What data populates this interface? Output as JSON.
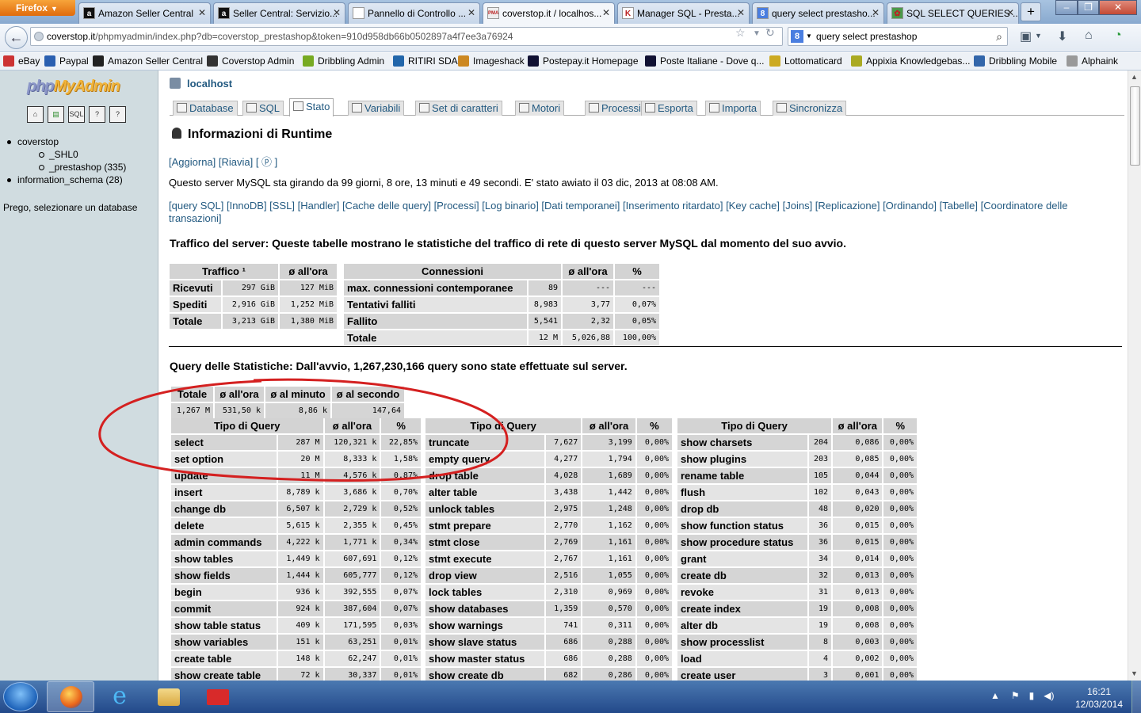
{
  "browser": {
    "app_button": "Firefox",
    "tabs": [
      {
        "label": "Amazon Seller Central",
        "fav": "a"
      },
      {
        "label": "Seller Central: Servizio...",
        "fav": "a"
      },
      {
        "label": "Pannello di Controllo ...",
        "fav": ""
      },
      {
        "label": "coverstop.it / localhos...",
        "fav": "PMA"
      },
      {
        "label": "Manager SQL - Presta...",
        "fav": "K"
      },
      {
        "label": "query select prestasho...",
        "fav": "8"
      },
      {
        "label": "SQL SELECT QUERIES ...",
        "fav": "✿"
      }
    ],
    "url_host": "coverstop.it",
    "url_path": "/phpmyadmin/index.php?db=coverstop_prestashop&token=910d958db66b0502897a4f7ee3a76924",
    "search_value": "query select prestashop",
    "bookmarks": [
      "eBay",
      "Paypal",
      "Amazon Seller Central",
      "Coverstop Admin",
      "Dribbling Admin",
      "RITIRI SDA",
      "Imageshack",
      "Postepay.it Homepage",
      "Poste Italiane - Dove q...",
      "Lottomaticard",
      "Appixia Knowledgebas...",
      "Dribbling Mobile",
      "Alphaink"
    ]
  },
  "sidebar": {
    "logo_php": "php",
    "logo_rest": "MyAdmin",
    "quick_icons": [
      "home-icon",
      "exit-icon",
      "sql-icon",
      "docs-icon",
      "help-icon"
    ],
    "db1": "coverstop",
    "db1_sub": [
      "_SHL0",
      "_prestashop (335)"
    ],
    "db2": "information_schema (28)",
    "select_prompt": "Prego, selezionare un database"
  },
  "main": {
    "server": "localhost",
    "tabs": [
      "Database",
      "SQL",
      "Stato",
      "Variabili",
      "Set di caratteri",
      "Motori",
      "Processi",
      "Esporta",
      "Importa",
      "Sincronizza"
    ],
    "active_tab": "Stato",
    "title": "Informazioni di Runtime",
    "links1": "[Aggiorna] [Riavia] [ ⓟ ]",
    "uptime": "Questo server MySQL sta girando da 99 giorni, 8 ore, 13 minuti e 49 secondi. E' stato awiato il 03 dic, 2013 at 08:08 AM.",
    "links2": "[query SQL] [InnoDB] [SSL] [Handler] [Cache delle query] [Processi] [Log binario] [Dati temporanei] [Inserimento ritardato] [Key cache] [Joins] [Replicazione] [Ordinando] [Tabelle] [Coordinatore delle transazioni]",
    "traffic_heading": "Traffico del server: Queste tabelle mostrano le statistiche del traffico di rete di questo server MySQL dal momento del suo avvio.",
    "query_heading": "Query delle Statistiche: Dall'avvio, 1,267,230,166 query sono state effettuate sul server."
  },
  "traffic": {
    "headers": [
      "Traffico ¹",
      "ø all'ora"
    ],
    "rows": [
      [
        "Ricevuti",
        "297 GiB",
        "127 MiB"
      ],
      [
        "Spediti",
        "2,916 GiB",
        "1,252 MiB"
      ],
      [
        "Totale",
        "3,213 GiB",
        "1,380 MiB"
      ]
    ]
  },
  "connections": {
    "headers": [
      "Connessioni",
      "ø all'ora",
      "%"
    ],
    "rows": [
      [
        "max. connessioni contemporanee",
        "89",
        "---",
        "---"
      ],
      [
        "Tentativi falliti",
        "8,983",
        "3,77",
        "0,07%"
      ],
      [
        "Fallito",
        "5,541",
        "2,32",
        "0,05%"
      ],
      [
        "Totale",
        "12 M",
        "5,026,88",
        "100,00%"
      ]
    ]
  },
  "query_totals": {
    "headers": [
      "Totale",
      "ø all'ora",
      "ø al minuto",
      "ø al secondo"
    ],
    "row": [
      "1,267 M",
      "531,50 k",
      "8,86 k",
      "147,64"
    ]
  },
  "query_types": {
    "headers": [
      "Tipo di Query",
      "ø all'ora",
      "%"
    ],
    "col1": [
      [
        "select",
        "287 M",
        "120,321 k",
        "22,85%"
      ],
      [
        "set option",
        "20 M",
        "8,333 k",
        "1,58%"
      ],
      [
        "update",
        "11 M",
        "4,576 k",
        "0,87%"
      ],
      [
        "insert",
        "8,789 k",
        "3,686 k",
        "0,70%"
      ],
      [
        "change db",
        "6,507 k",
        "2,729 k",
        "0,52%"
      ],
      [
        "delete",
        "5,615 k",
        "2,355 k",
        "0,45%"
      ],
      [
        "admin commands",
        "4,222 k",
        "1,771 k",
        "0,34%"
      ],
      [
        "show tables",
        "1,449 k",
        "607,691",
        "0,12%"
      ],
      [
        "show fields",
        "1,444 k",
        "605,777",
        "0,12%"
      ],
      [
        "begin",
        "936 k",
        "392,555",
        "0,07%"
      ],
      [
        "commit",
        "924 k",
        "387,604",
        "0,07%"
      ],
      [
        "show table status",
        "409 k",
        "171,595",
        "0,03%"
      ],
      [
        "show variables",
        "151 k",
        "63,251",
        "0,01%"
      ],
      [
        "create table",
        "148 k",
        "62,247",
        "0,01%"
      ],
      [
        "show create table",
        "72 k",
        "30,337",
        "0,01%"
      ]
    ],
    "col2": [
      [
        "truncate",
        "7,627",
        "3,199",
        "0,00%"
      ],
      [
        "empty query",
        "4,277",
        "1,794",
        "0,00%"
      ],
      [
        "drop table",
        "4,028",
        "1,689",
        "0,00%"
      ],
      [
        "alter table",
        "3,438",
        "1,442",
        "0,00%"
      ],
      [
        "unlock tables",
        "2,975",
        "1,248",
        "0,00%"
      ],
      [
        "stmt prepare",
        "2,770",
        "1,162",
        "0,00%"
      ],
      [
        "stmt close",
        "2,769",
        "1,161",
        "0,00%"
      ],
      [
        "stmt execute",
        "2,767",
        "1,161",
        "0,00%"
      ],
      [
        "drop view",
        "2,516",
        "1,055",
        "0,00%"
      ],
      [
        "lock tables",
        "2,310",
        "0,969",
        "0,00%"
      ],
      [
        "show databases",
        "1,359",
        "0,570",
        "0,00%"
      ],
      [
        "show warnings",
        "741",
        "0,311",
        "0,00%"
      ],
      [
        "show slave status",
        "686",
        "0,288",
        "0,00%"
      ],
      [
        "show master status",
        "686",
        "0,288",
        "0,00%"
      ],
      [
        "show create db",
        "682",
        "0,286",
        "0,00%"
      ]
    ],
    "col3": [
      [
        "show charsets",
        "204",
        "0,086",
        "0,00%"
      ],
      [
        "show plugins",
        "203",
        "0,085",
        "0,00%"
      ],
      [
        "rename table",
        "105",
        "0,044",
        "0,00%"
      ],
      [
        "flush",
        "102",
        "0,043",
        "0,00%"
      ],
      [
        "drop db",
        "48",
        "0,020",
        "0,00%"
      ],
      [
        "show function status",
        "36",
        "0,015",
        "0,00%"
      ],
      [
        "show procedure status",
        "36",
        "0,015",
        "0,00%"
      ],
      [
        "grant",
        "34",
        "0,014",
        "0,00%"
      ],
      [
        "create db",
        "32",
        "0,013",
        "0,00%"
      ],
      [
        "revoke",
        "31",
        "0,013",
        "0,00%"
      ],
      [
        "create index",
        "19",
        "0,008",
        "0,00%"
      ],
      [
        "alter db",
        "19",
        "0,008",
        "0,00%"
      ],
      [
        "show processlist",
        "8",
        "0,003",
        "0,00%"
      ],
      [
        "load",
        "4",
        "0,002",
        "0,00%"
      ],
      [
        "create user",
        "3",
        "0,001",
        "0,00%"
      ]
    ]
  },
  "taskbar": {
    "time": "16:21",
    "date": "12/03/2014"
  },
  "colors": {
    "link": "#235a81",
    "annotation": "#d42020"
  }
}
